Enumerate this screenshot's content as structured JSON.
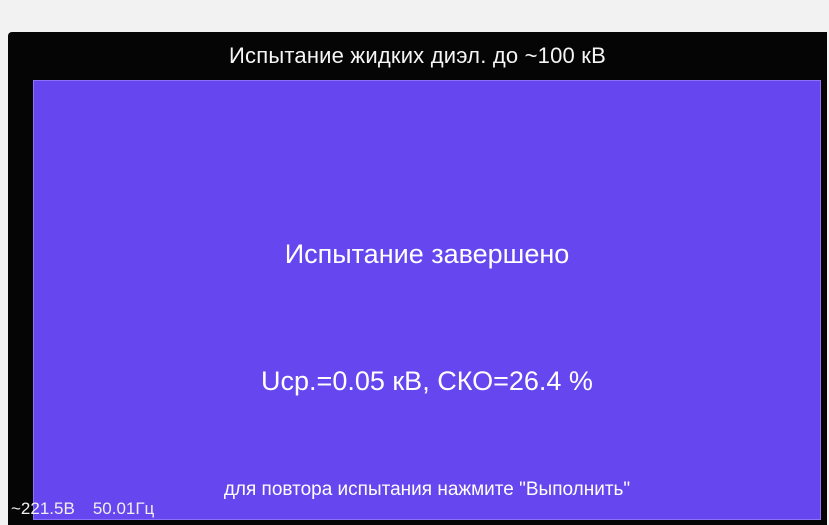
{
  "header": {
    "title": "Испытание жидких диэл. до ~100 кВ"
  },
  "main": {
    "status_message": "Испытание завершено",
    "result_line": "Uср.=0.05 кВ, СКО=26.4 %",
    "hint": "для повтора испытания нажмите \"Выполнить\""
  },
  "status_bar": {
    "voltage": "~221.5В",
    "frequency": "50.01Гц"
  },
  "colors": {
    "panel_background": "#6646ee",
    "screen_background": "#050505",
    "text": "#ffffff"
  }
}
